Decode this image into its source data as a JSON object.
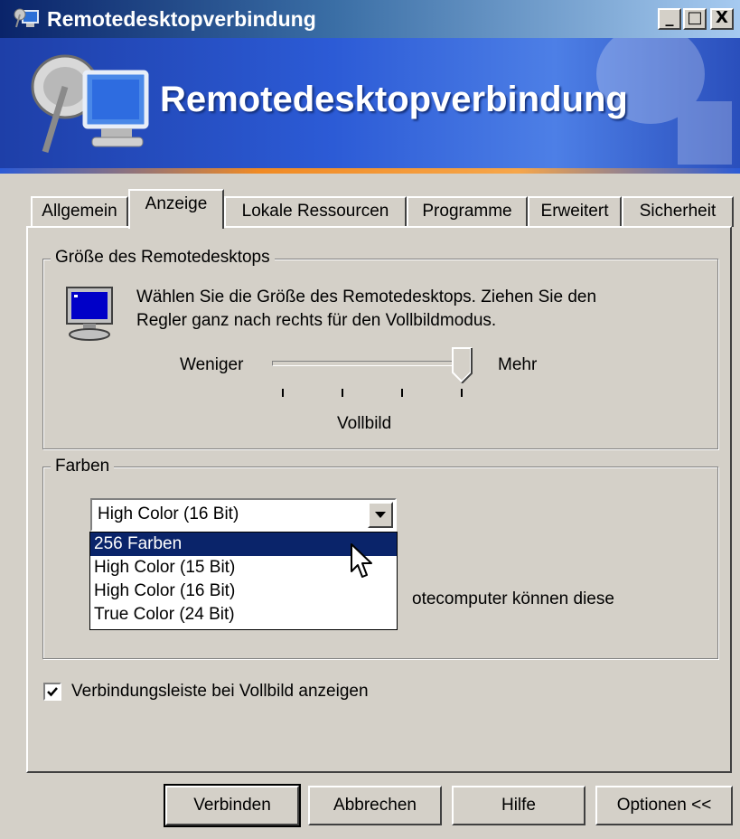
{
  "window": {
    "title": "Remotedesktopverbindung",
    "controls": {
      "minimize": "_",
      "maximize": "□",
      "close": "X"
    }
  },
  "banner": {
    "title": "Remotedesktopverbindung"
  },
  "tabs": [
    {
      "label": "Allgemein",
      "active": false
    },
    {
      "label": "Anzeige",
      "active": true
    },
    {
      "label": "Lokale Ressourcen",
      "active": false
    },
    {
      "label": "Programme",
      "active": false
    },
    {
      "label": "Erweitert",
      "active": false
    },
    {
      "label": "Sicherheit",
      "active": false
    }
  ],
  "size_group": {
    "legend": "Größe des Remotedesktops",
    "description_line1": "Wählen Sie die Größe des Remotedesktops. Ziehen Sie den",
    "description_line2": "Regler ganz nach rechts für den Vollbildmodus.",
    "slider": {
      "min_label": "Weniger",
      "max_label": "Mehr",
      "value_label": "Vollbild",
      "position": "max",
      "tick_count": 4
    }
  },
  "colors_group": {
    "legend": "Farben",
    "selected_value": "High Color (16 Bit)",
    "dropdown_options": [
      "256 Farben",
      "High Color (15 Bit)",
      "High Color (16 Bit)",
      "True Color (24 Bit)"
    ],
    "highlighted_option": "256 Farben",
    "note_visible_fragment": "otecomputer können diese"
  },
  "connection_bar_checkbox": {
    "label": "Verbindungsleiste bei Vollbild anzeigen",
    "checked": true
  },
  "buttons": {
    "connect": "Verbinden",
    "cancel": "Abbrechen",
    "help": "Hilfe",
    "options": "Optionen <<"
  },
  "theme": {
    "title_dark": "#0a246a",
    "banner_blue": "#2c5bd6",
    "accent_orange": "#f08a24",
    "selection": "#0a246a"
  }
}
